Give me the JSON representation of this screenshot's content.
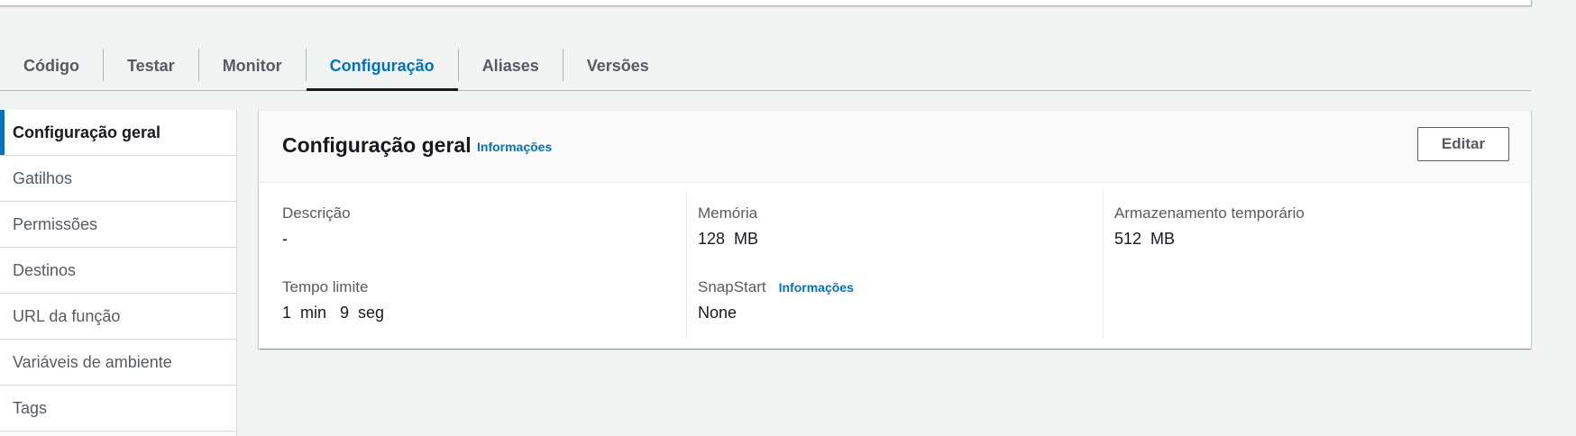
{
  "tabs": [
    {
      "label": "Código"
    },
    {
      "label": "Testar"
    },
    {
      "label": "Monitor"
    },
    {
      "label": "Configuração",
      "active": true
    },
    {
      "label": "Aliases"
    },
    {
      "label": "Versões"
    }
  ],
  "sidenav": {
    "items": [
      {
        "label": "Configuração geral",
        "active": true
      },
      {
        "label": "Gatilhos"
      },
      {
        "label": "Permissões"
      },
      {
        "label": "Destinos"
      },
      {
        "label": "URL da função"
      },
      {
        "label": "Variáveis de ambiente"
      },
      {
        "label": "Tags"
      }
    ]
  },
  "card": {
    "title": "Configuração geral",
    "info_link": "Informações",
    "edit_label": "Editar",
    "fields": {
      "description": {
        "label": "Descrição",
        "value": "-"
      },
      "timeout": {
        "label": "Tempo limite",
        "value": "1  min   9  seg"
      },
      "memory": {
        "label": "Memória",
        "value": "128  MB"
      },
      "snapstart": {
        "label": "SnapStart",
        "info_link": "Informações",
        "value": "None"
      },
      "ephemeral_storage": {
        "label": "Armazenamento temporário",
        "value": "512  MB"
      }
    }
  },
  "colors": {
    "accent": "#0073bb",
    "text": "#16191f",
    "muted": "#545b64",
    "background": "#f2f3f3"
  }
}
